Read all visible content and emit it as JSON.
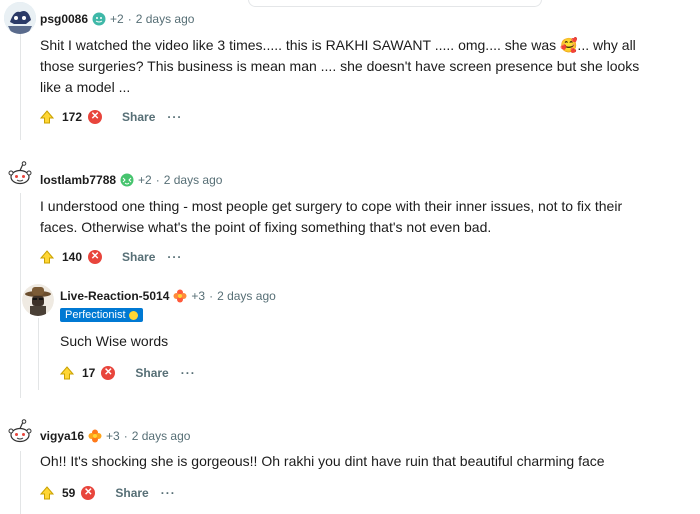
{
  "comments": [
    {
      "username": "psg0086",
      "flair_icon": "teal-emoji-icon",
      "karma": "+2",
      "time": "2 days ago",
      "body_lines": [
        "Shit I watched the video like 3 times..... this is RAKHI SAWANT ..... omg.... she was 🥰... why all",
        "those surgeries? This business is mean man .... she doesn't have screen presence but she looks",
        "like a model ..."
      ],
      "score": "172",
      "share_label": "Share",
      "more_label": "···"
    },
    {
      "username": "lostlamb7788",
      "flair_icon": "sparkle-emoji-icon",
      "karma": "+2",
      "time": "2 days ago",
      "body_lines": [
        "I understood one thing - most people get surgery to cope with their inner issues, not to fix their",
        "faces. Otherwise what's the point of fixing something that's not even bad."
      ],
      "score": "140",
      "share_label": "Share",
      "more_label": "···"
    },
    {
      "username": "Live-Reaction-5014",
      "flair_icon": "flower-emoji-icon",
      "karma": "+3",
      "time": "2 days ago",
      "user_flair": "Perfectionist",
      "body_lines": [
        "Such Wise words"
      ],
      "score": "17",
      "share_label": "Share",
      "more_label": "···"
    },
    {
      "username": "vigya16",
      "flair_icon": "orange-flower-icon",
      "karma": "+3",
      "time": "2 days ago",
      "body_lines": [
        "Oh!! It's shocking she is gorgeous!! Oh rakhi you dint have ruin that beautiful charming face"
      ],
      "score": "59",
      "share_label": "Share",
      "more_label": "···"
    }
  ],
  "separator": "·",
  "colors": {
    "accent": "#0079d3",
    "downvote": "#e8453c",
    "upvote": "#ffd635",
    "meta": "#576f76"
  }
}
